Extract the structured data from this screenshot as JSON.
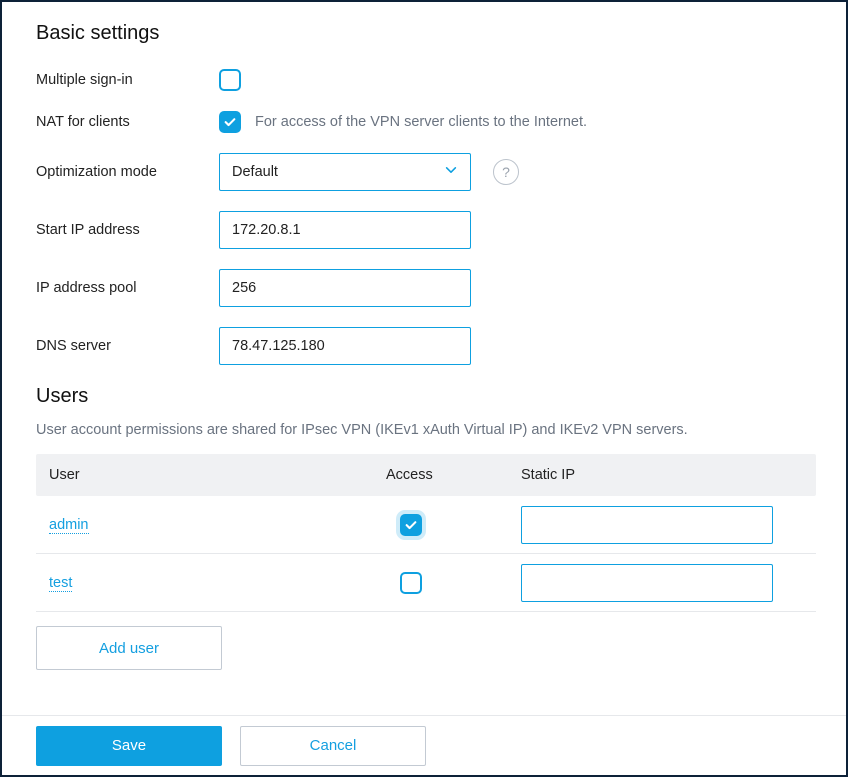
{
  "basic": {
    "title": "Basic settings",
    "multipleSignIn": {
      "label": "Multiple sign-in",
      "checked": false
    },
    "natForClients": {
      "label": "NAT for clients",
      "checked": true,
      "hint": "For access of the VPN server clients to the Internet."
    },
    "optimizationMode": {
      "label": "Optimization mode",
      "value": "Default"
    },
    "startIp": {
      "label": "Start IP address",
      "value": "172.20.8.1"
    },
    "ipPool": {
      "label": "IP address pool",
      "value": "256"
    },
    "dnsServer": {
      "label": "DNS server",
      "value": "78.47.125.180"
    }
  },
  "users": {
    "title": "Users",
    "description": "User account permissions are shared for IPsec VPN (IKEv1 xAuth Virtual IP) and IKEv2 VPN servers.",
    "columns": {
      "user": "User",
      "access": "Access",
      "staticIp": "Static IP"
    },
    "rows": [
      {
        "name": "admin",
        "access": true,
        "staticIp": ""
      },
      {
        "name": "test",
        "access": false,
        "staticIp": ""
      }
    ],
    "addUserLabel": "Add user"
  },
  "footer": {
    "save": "Save",
    "cancel": "Cancel"
  },
  "icons": {
    "help": "?"
  }
}
